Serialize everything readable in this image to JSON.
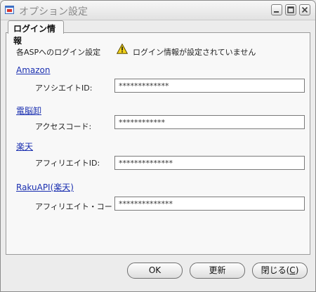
{
  "window": {
    "title": "オプション設定",
    "controls": [
      "minimize-icon",
      "maximize-icon",
      "close-icon"
    ]
  },
  "tab": {
    "label": "ログイン情報"
  },
  "header": {
    "label": "各ASPへのログイン設定",
    "warning_text": "ログイン情報が設定されていません",
    "warning_icon": "warning-icon"
  },
  "sections": [
    {
      "link": "Amazon",
      "field_label": "アソシエイトID:",
      "value": "*************"
    },
    {
      "link": "電脳卸",
      "field_label": "アクセスコード:",
      "value": "************"
    },
    {
      "link": "楽天",
      "field_label": "アフィリエイトID:",
      "value": "**************"
    },
    {
      "link": "RakuAPI(楽天)",
      "field_label": "アフィリエイト・コード:",
      "value": "**************"
    }
  ],
  "buttons": {
    "ok": "OK",
    "update": "更新",
    "close": "閉じる(",
    "close_key": "C",
    "close_suffix": ")"
  },
  "colors": {
    "link": "#1a2fb0",
    "warning": "#f2d21a"
  }
}
